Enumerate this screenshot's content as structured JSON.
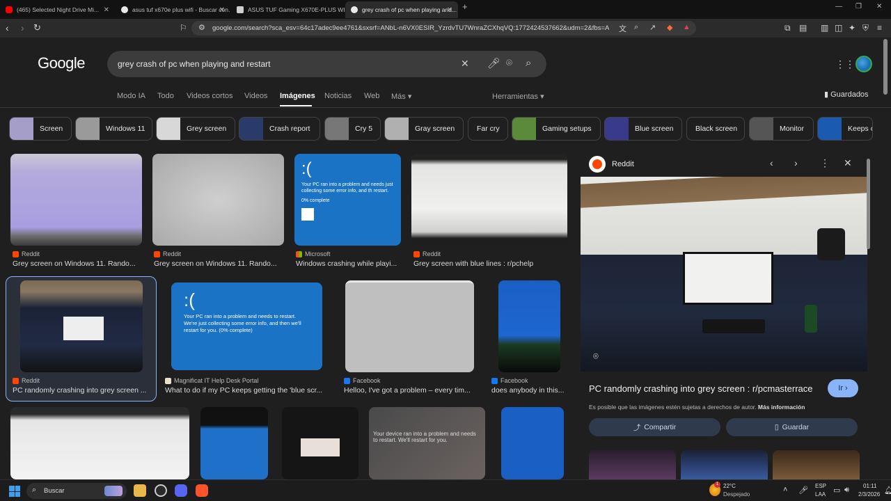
{
  "browser": {
    "tabs": [
      {
        "title": "(465) Selected Night Drive Mi..."
      },
      {
        "title": "asus tuf x670e plus wifi - Buscar con..."
      },
      {
        "title": "ASUS TUF Gaming X670E-PLUS WIFI..."
      },
      {
        "title": "grey crash of pc when playing and..."
      }
    ],
    "url": "google.com/search?sca_esv=64c17adec9ee4761&sxsrf=ANbL-n6VX0ESIR_YzrdvTU7WnraZCXhqVQ:1772424537662&udm=2&fbs=ADc_l-..."
  },
  "google": {
    "logo": "Google",
    "query": "grey crash of pc when playing and restart",
    "tabs": [
      "Modo IA",
      "Todo",
      "Videos cortos",
      "Videos",
      "Imágenes",
      "Noticias",
      "Web",
      "Más"
    ],
    "tools": "Herramientas",
    "saved": "Guardados",
    "chips": [
      "Screen",
      "Windows 11",
      "Grey screen",
      "Crash report",
      "Cry 5",
      "Gray screen",
      "Far cry",
      "Gaming setups",
      "Blue screen",
      "Black screen",
      "Monitor",
      "Keeps c"
    ],
    "results": [
      {
        "source": "Reddit",
        "title": "Grey screen on Windows 11. Rando..."
      },
      {
        "source": "Reddit",
        "title": "Grey screen on Windows 11. Rando..."
      },
      {
        "source": "Microsoft",
        "title": "Windows crashing while playi..."
      },
      {
        "source": "Reddit",
        "title": "Grey screen with blue lines : r/pchelp"
      },
      {
        "source": "Reddit",
        "title": "PC randomly crashing into grey screen ..."
      },
      {
        "source": "Magnificat IT Help Desk Portal",
        "title": "What to do if my PC keeps getting the 'blue scr..."
      },
      {
        "source": "Facebook",
        "title": "Helloo, I've got a problem – every tim..."
      },
      {
        "source": "Facebook",
        "title": "does anybody in this..."
      }
    ],
    "bsod_small": {
      "face": ":(",
      "text": "Your PC ran into a problem and needs just collecting some error info, and th restart.",
      "percent": "0% complete"
    },
    "bsod_large": {
      "face": ":(",
      "text": "Your PC ran into a problem and needs to restart. We're just collecting some error info, and then we'll restart for you. (0% complete)"
    },
    "bsod_photo": "Your device ran into a problem and needs to restart. We'll restart for you."
  },
  "panel": {
    "source": "Reddit",
    "title": "PC randomly crashing into grey screen : r/pcmasterrace",
    "go": "Ir",
    "copyright": "Es posible que las imágenes estén sujetas a derechos de autor.",
    "more_info": "Más información",
    "share": "Compartir",
    "save": "Guardar"
  },
  "taskbar": {
    "search": "Buscar",
    "temp": "22°C",
    "weather": "Despejado",
    "lang": "ESP",
    "layout": "LAA",
    "time": "01:11",
    "date": "2/3/2026",
    "badge": "1"
  }
}
